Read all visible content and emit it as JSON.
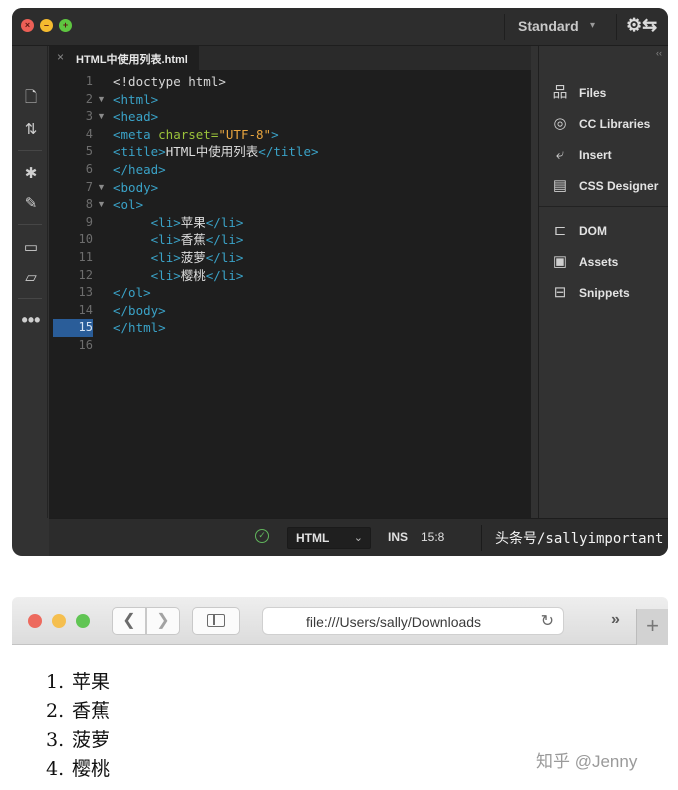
{
  "dreamweaver": {
    "workspace": "Standard",
    "tab": {
      "filename": "HTML中使用列表.html"
    },
    "active_line": "15",
    "code_lines": [
      {
        "num": "1",
        "fold": "",
        "tokens": [
          [
            "t-plain",
            "<!doctype html>"
          ]
        ]
      },
      {
        "num": "2",
        "fold": "▼",
        "tokens": [
          [
            "t-tag",
            "<html>"
          ]
        ]
      },
      {
        "num": "3",
        "fold": "▼",
        "tokens": [
          [
            "t-tag",
            "<head>"
          ]
        ]
      },
      {
        "num": "4",
        "fold": "",
        "tokens": [
          [
            "t-tag",
            "<meta "
          ],
          [
            "t-attr",
            "charset="
          ],
          [
            "t-val",
            "\"UTF-8\""
          ],
          [
            "t-tag",
            ">"
          ]
        ]
      },
      {
        "num": "5",
        "fold": "",
        "tokens": [
          [
            "t-tag",
            "<title>"
          ],
          [
            "t-text",
            "HTML中使用列表"
          ],
          [
            "t-tag",
            "</title>"
          ]
        ]
      },
      {
        "num": "6",
        "fold": "",
        "tokens": [
          [
            "t-tag",
            "</head>"
          ]
        ]
      },
      {
        "num": "7",
        "fold": "▼",
        "tokens": [
          [
            "t-tag",
            "<body>"
          ]
        ]
      },
      {
        "num": "8",
        "fold": "▼",
        "tokens": [
          [
            "t-tag",
            "<ol>"
          ]
        ]
      },
      {
        "num": "9",
        "fold": "",
        "tokens": [
          [
            "t-plain",
            "     "
          ],
          [
            "t-tag",
            "<li>"
          ],
          [
            "t-text",
            "苹果"
          ],
          [
            "t-tag",
            "</li>"
          ]
        ]
      },
      {
        "num": "10",
        "fold": "",
        "tokens": [
          [
            "t-plain",
            "     "
          ],
          [
            "t-tag",
            "<li>"
          ],
          [
            "t-text",
            "香蕉"
          ],
          [
            "t-tag",
            "</li>"
          ]
        ]
      },
      {
        "num": "11",
        "fold": "",
        "tokens": [
          [
            "t-plain",
            "     "
          ],
          [
            "t-tag",
            "<li>"
          ],
          [
            "t-text",
            "菠萝"
          ],
          [
            "t-tag",
            "</li>"
          ]
        ]
      },
      {
        "num": "12",
        "fold": "",
        "tokens": [
          [
            "t-plain",
            "     "
          ],
          [
            "t-tag",
            "<li>"
          ],
          [
            "t-text",
            "樱桃"
          ],
          [
            "t-tag",
            "</li>"
          ]
        ]
      },
      {
        "num": "13",
        "fold": "",
        "tokens": [
          [
            "t-tag",
            "</ol>"
          ]
        ]
      },
      {
        "num": "14",
        "fold": "",
        "tokens": [
          [
            "t-tag",
            "</body>"
          ]
        ]
      },
      {
        "num": "15",
        "fold": "",
        "tokens": [
          [
            "t-tag",
            "</html>"
          ]
        ]
      },
      {
        "num": "16",
        "fold": "",
        "tokens": []
      }
    ],
    "panels": [
      {
        "name": "files",
        "label": "Files",
        "icon": "files-tree-icon",
        "glyph": "品"
      },
      {
        "name": "cc-libraries",
        "label": "CC Libraries",
        "icon": "cc-libraries-icon",
        "glyph": "◎"
      },
      {
        "name": "insert",
        "label": "Insert",
        "icon": "insert-icon",
        "glyph": "⤶"
      },
      {
        "name": "css-designer",
        "label": "CSS Designer",
        "icon": "css-designer-icon",
        "glyph": "▤"
      },
      {
        "name": "dom",
        "label": "DOM",
        "icon": "dom-icon",
        "glyph": "⊏"
      },
      {
        "name": "assets",
        "label": "Assets",
        "icon": "assets-icon",
        "glyph": "▣"
      },
      {
        "name": "snippets",
        "label": "Snippets",
        "icon": "snippets-icon",
        "glyph": "⊟"
      }
    ],
    "status": {
      "language": "HTML",
      "mode": "INS",
      "cursor": "15:8",
      "watermark": "头条号/sallyimportant"
    }
  },
  "safari": {
    "url": "file:///Users/sally/Downloads",
    "list_items": [
      {
        "num": "1.",
        "text": "苹果"
      },
      {
        "num": "2.",
        "text": "香蕉"
      },
      {
        "num": "3.",
        "text": "菠萝"
      },
      {
        "num": "4.",
        "text": "樱桃"
      }
    ],
    "watermark": "知乎 @Jenny"
  },
  "colors": {
    "tag": "#3aa2c7",
    "attr": "#9bc33a",
    "value": "#e7a43e",
    "active_line_bg": "#2a5d99"
  }
}
